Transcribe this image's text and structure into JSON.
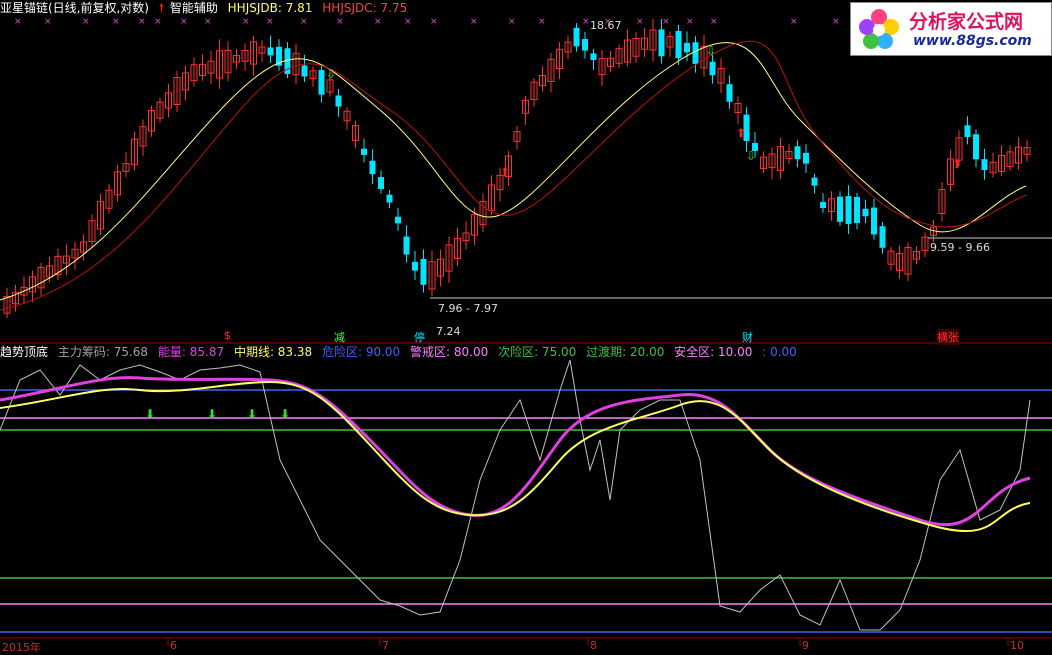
{
  "upper": {
    "stock_name": "亚星锚链(日线,前复权,对数)",
    "indicator_name": "智能辅助",
    "hhjsjdb_label": "HHJSJDB: 7.81",
    "hhjsjdc_label": "HHJSJDC: 7.75",
    "price_labels": {
      "high": "18.67",
      "low_range": "7.96 - 7.97",
      "low": "7.24",
      "right_range": "9.59 - 9.66"
    },
    "signal_labels": [
      "$",
      "减",
      "停",
      "财",
      "横张"
    ]
  },
  "lower": {
    "title": "趋势顶底",
    "main_chip": "主力筹码: 75.68",
    "energy": "能量: 85.87",
    "midline": "中期线: 83.38",
    "danger_zone": "危险区: 90.00",
    "alert_zone": "警戒区: 80.00",
    "sub_danger": "次险区: 75.00",
    "transition": "过渡期: 20.00",
    "safe_zone": "安全区: 10.00",
    "extra": ": 0.00"
  },
  "time_axis": [
    "2015年",
    "6",
    "7",
    "8",
    "9",
    "10"
  ],
  "logo": {
    "name": "分析家公式网",
    "url": "www.88gs.com"
  },
  "colors": {
    "up": "#ff3030",
    "down": "#00e5ff",
    "ma_fast": "#ffff80",
    "ma_slow": "#c01010",
    "energy": "#e040e0",
    "midline": "#ffff60",
    "chip": "#c0c0c0",
    "danger": "#4060ff",
    "alert": "#ff80ff",
    "sub_danger": "#40c040",
    "transition": "#40c040",
    "safe": "#ff80ff"
  }
}
